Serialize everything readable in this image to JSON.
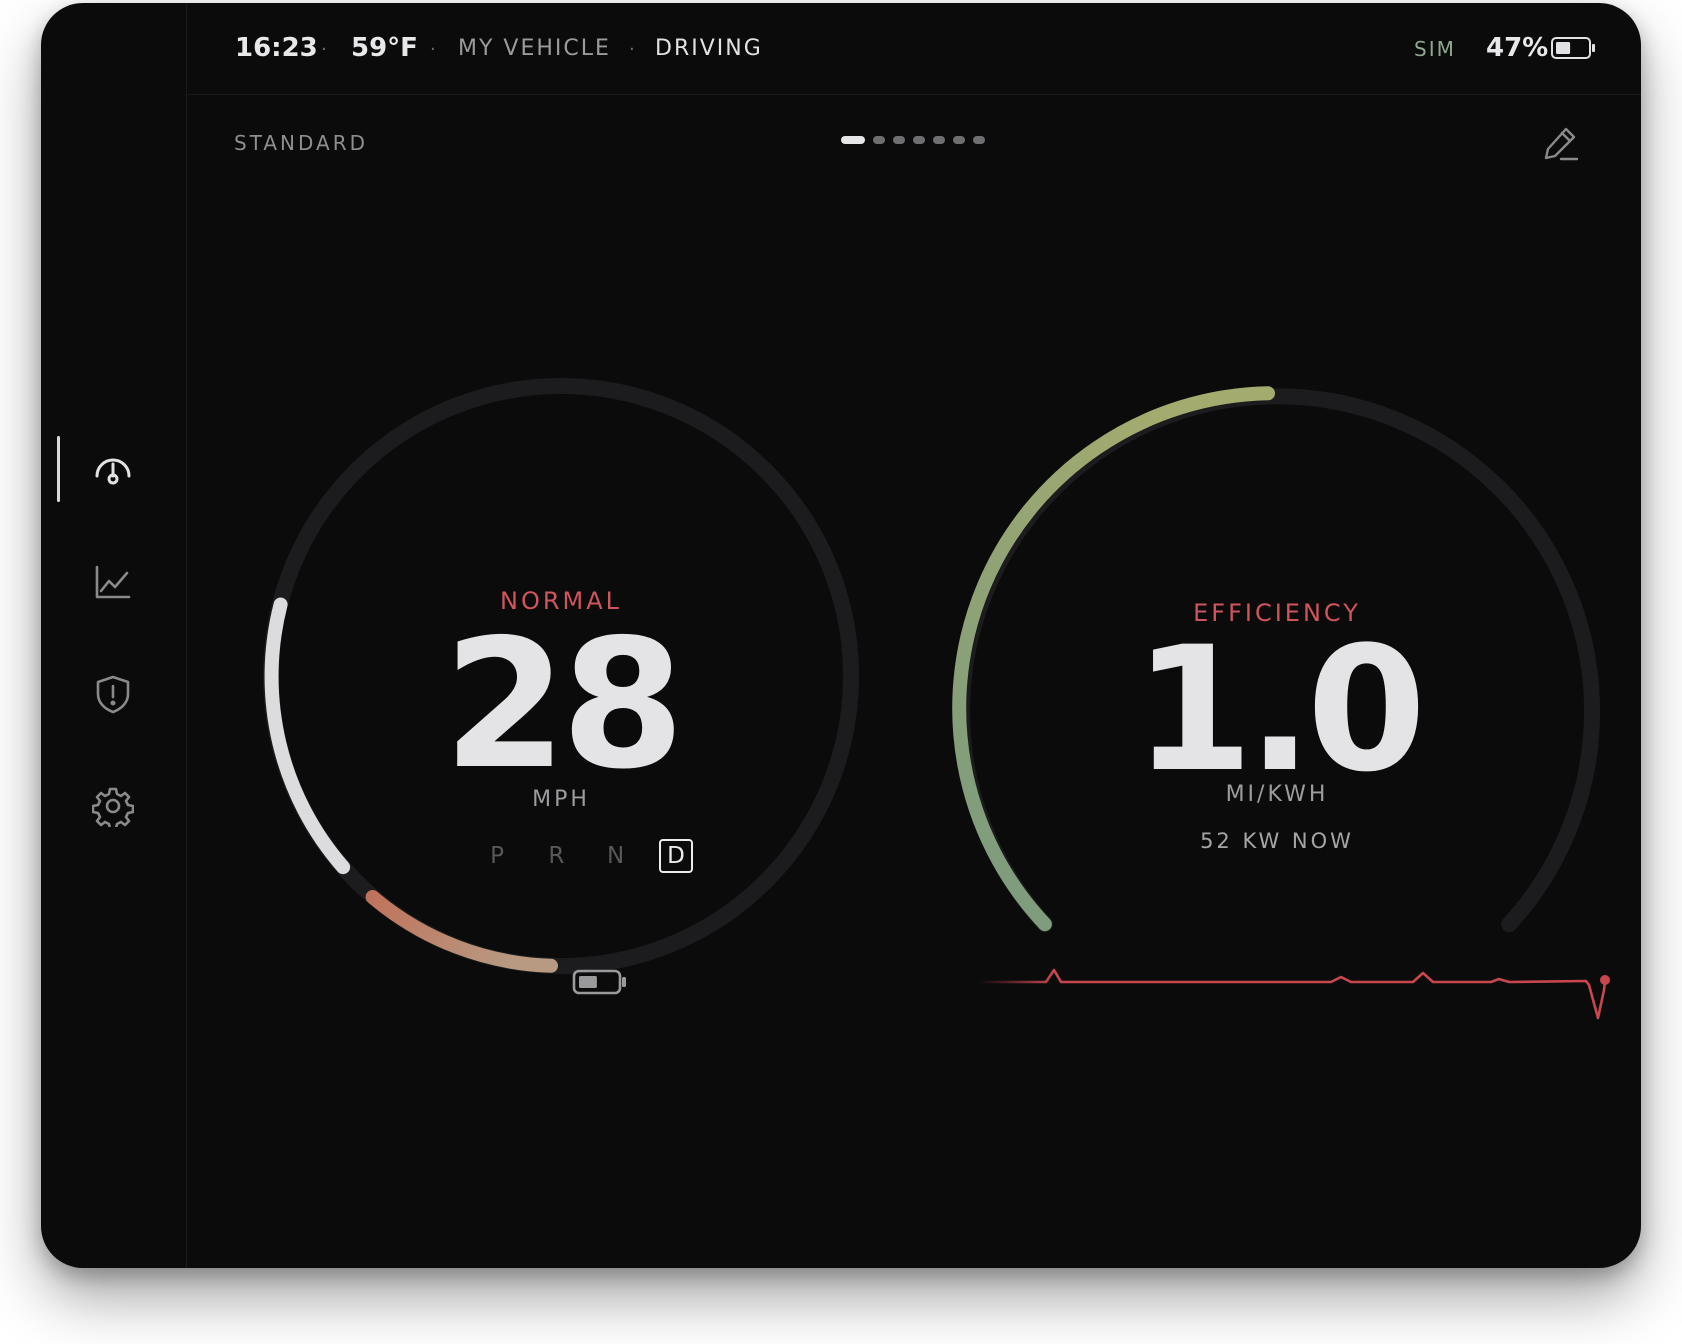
{
  "statusbar": {
    "time": "16:23",
    "separator": "·",
    "temperature": "59°F",
    "vehicle": "MY VEHICLE",
    "state": "DRIVING",
    "sim": "SIM",
    "battery": "47%",
    "battery_level": 0.47
  },
  "rail": {
    "items": [
      {
        "icon": "speedometer-icon",
        "active": true
      },
      {
        "icon": "chart-icon",
        "active": false
      },
      {
        "icon": "shield-alert-icon",
        "active": false
      },
      {
        "icon": "gear-icon",
        "active": false
      }
    ]
  },
  "header": {
    "mode": "STANDARD",
    "page_count": 7,
    "active_page": 1,
    "edit_icon": "pencil-icon"
  },
  "speed_gauge": {
    "mode": "NORMAL",
    "value": "28",
    "unit": "MPH",
    "gears": [
      "P",
      "R",
      "N",
      "D"
    ],
    "selected_gear": "D",
    "icon": "battery-icon",
    "colors": {
      "mode": "#d0545b",
      "speed_arc": "#dcdcde",
      "regen_arc_start": "#c0735c",
      "regen_arc_end": "#b89a82"
    }
  },
  "efficiency_gauge": {
    "title": "EFFICIENCY",
    "value": "1.0",
    "unit": "MI/KWH",
    "sub": "52 KW NOW",
    "colors": {
      "title": "#d0545b",
      "arc_start": "#7a9a7e",
      "arc_end": "#a4ab6e",
      "trace": "#c8474f"
    }
  }
}
